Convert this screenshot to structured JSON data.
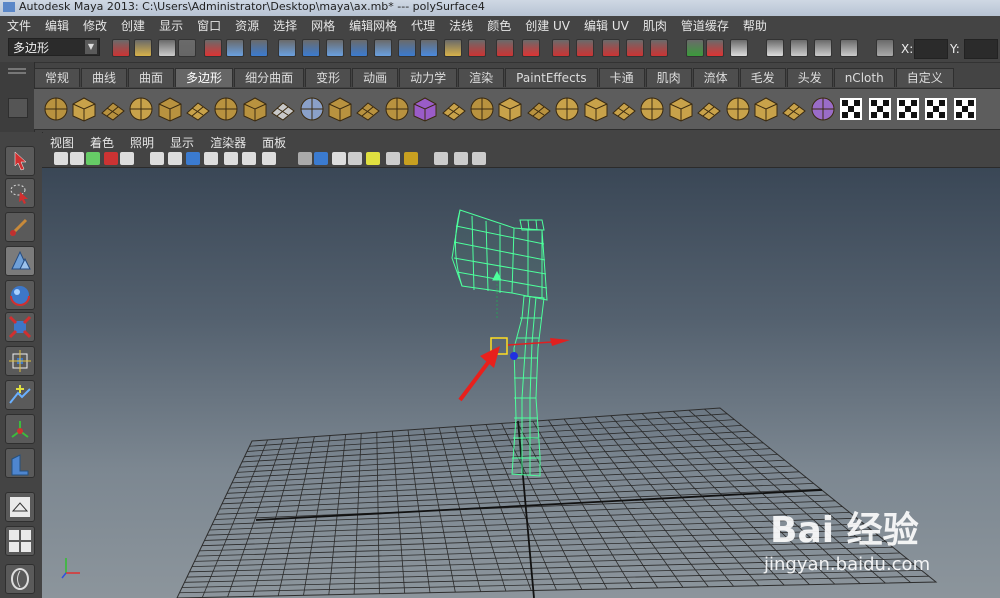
{
  "window": {
    "title": "Autodesk Maya 2013: C:\\Users\\Administrator\\Desktop\\maya\\ax.mb*   ---   polySurface4"
  },
  "menubar": {
    "items": [
      "文件",
      "编辑",
      "修改",
      "创建",
      "显示",
      "窗口",
      "资源",
      "选择",
      "网格",
      "编辑网格",
      "代理",
      "法线",
      "颜色",
      "创建 UV",
      "编辑 UV",
      "肌肉",
      "管道缓存",
      "帮助"
    ]
  },
  "status_line": {
    "mode": "多边形",
    "x_label": "X:",
    "y_label": "Y:"
  },
  "shelf": {
    "tabs": [
      "常规",
      "曲线",
      "曲面",
      "多边形",
      "细分曲面",
      "变形",
      "动画",
      "动力学",
      "渲染",
      "PaintEffects",
      "卡通",
      "肌肉",
      "流体",
      "毛发",
      "头发",
      "nCloth",
      "自定义"
    ],
    "active_tab": "多边形"
  },
  "panel_menu": {
    "items": [
      "视图",
      "着色",
      "照明",
      "显示",
      "渲染器",
      "面板"
    ]
  },
  "viewport": {
    "object": "polySurface4",
    "mesh_color": "#4dff9c",
    "annotation_color": "#e8201c"
  },
  "watermark": {
    "brand": "Bai 经验",
    "url": "jingyan.baidu.com"
  }
}
